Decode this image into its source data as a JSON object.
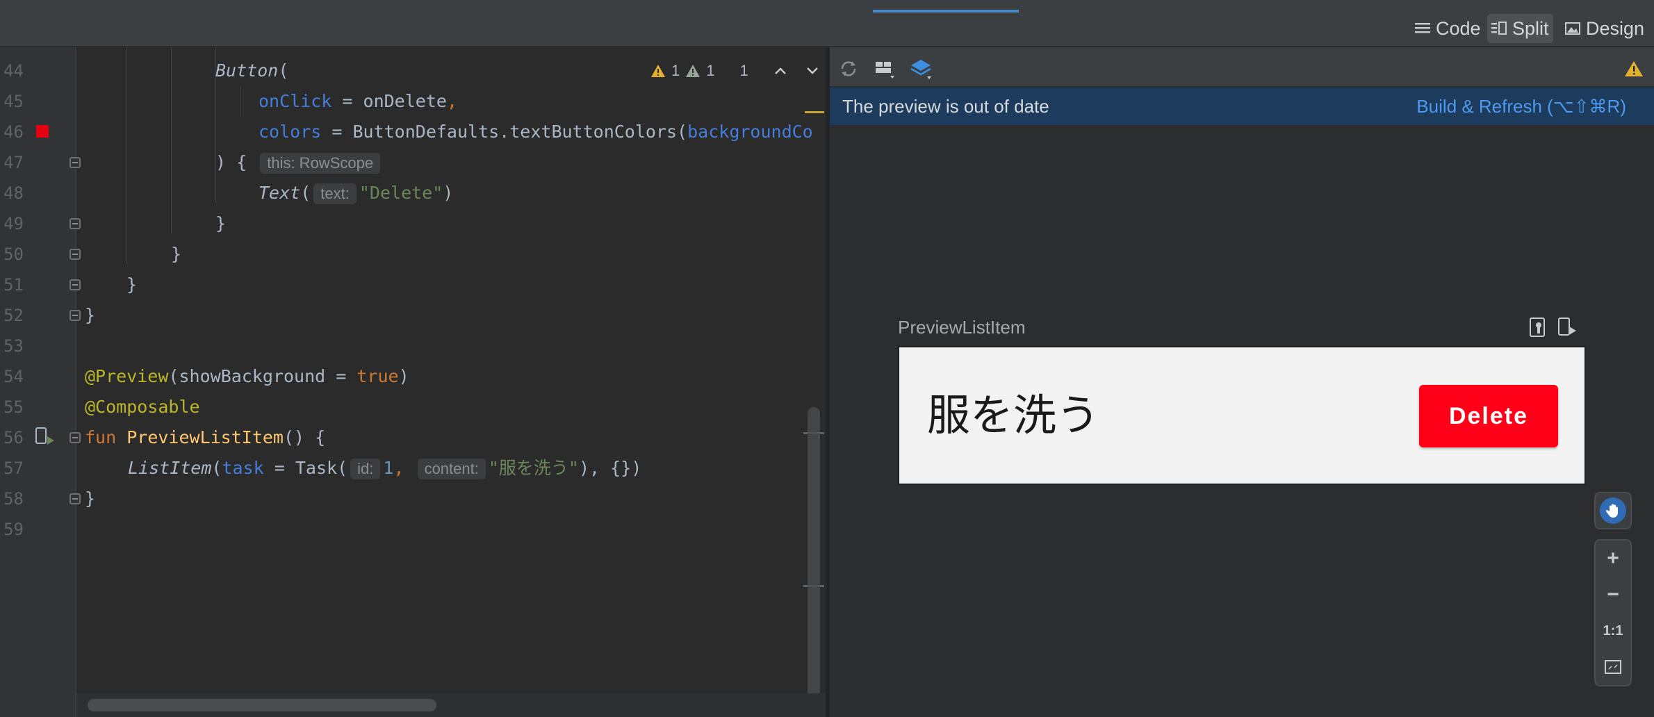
{
  "header": {
    "modes": [
      {
        "label": "Code",
        "icon": "list-icon",
        "active": false
      },
      {
        "label": "Split",
        "icon": "split-view-icon",
        "active": true
      },
      {
        "label": "Design",
        "icon": "image-icon",
        "active": false
      }
    ]
  },
  "editor": {
    "inspections": {
      "warnings": "1",
      "weak_warnings": "1",
      "typos": "1"
    },
    "line_numbers": [
      "44",
      "45",
      "46",
      "47",
      "48",
      "49",
      "50",
      "51",
      "52",
      "53",
      "54",
      "55",
      "56",
      "57",
      "58",
      "59"
    ],
    "code": {
      "l44_fn": "Button",
      "l44_paren": "(",
      "l45_param": "onClick",
      "l45_eq": " = ",
      "l45_val": "onDelete",
      "l45_comma": ",",
      "l46_param": "colors",
      "l46_eq": " = ",
      "l46_call": "ButtonDefaults.textButtonColors(",
      "l46_arg": "backgroundCo",
      "l47_brace": ") {",
      "l47_hint": "this: RowScope",
      "l48_fn": "Text",
      "l48_paren": "(",
      "l48_hint": "text:",
      "l48_str": "\"Delete\"",
      "l48_close": ")",
      "l49": "}",
      "l50": "}",
      "l51": "}",
      "l52": "}",
      "l54_ann": "@Preview",
      "l54_open": "(",
      "l54_param": "showBackground",
      "l54_eq": " = ",
      "l54_val": "true",
      "l54_close": ")",
      "l55_ann": "@Composable",
      "l56_kw": "fun",
      "l56_fn": "PreviewListItem",
      "l56_rest": "() {",
      "l57_fn": "ListItem",
      "l57_open": "(",
      "l57_param": "task",
      "l57_eq": " = ",
      "l57_call": "Task(",
      "l57_hint_id": "id:",
      "l57_num": "1",
      "l57_comma": ",",
      "l57_hint_content": "content:",
      "l57_str": "\"服を洗う\"",
      "l57_close": "),",
      "l57_lambda": "{}",
      "l57_end": ")",
      "l58": "}"
    }
  },
  "preview": {
    "banner_message": "The preview is out of date",
    "banner_action": "Build & Refresh (⌥⇧⌘R)",
    "component_name": "PreviewListItem",
    "task_text": "服を洗う",
    "delete_label": "Delete",
    "zoom": {
      "in": "+",
      "out": "−",
      "actual": "1:1"
    }
  },
  "colors": {
    "accent": "#4a88c7",
    "delete_button": "#ff0019",
    "banner_bg": "#1d3b5c",
    "link": "#4e9af0",
    "warning": "#e2b12f"
  }
}
